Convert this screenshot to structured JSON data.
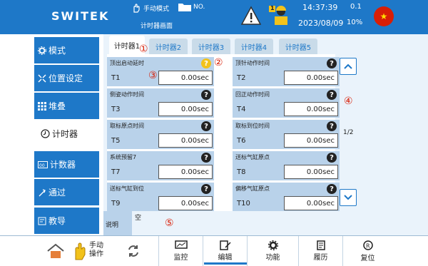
{
  "header": {
    "logo": "SWITEK",
    "mode_label": "手动模式",
    "screen_name": "计时器画面",
    "file_no": "NO.",
    "time": "14:37:39",
    "date": "2023/08/09",
    "rate": "0.1",
    "percent": "10%",
    "flag_icon": "china-flag-icon",
    "user_badge": "1"
  },
  "sidebar": {
    "items": [
      {
        "label": "模式",
        "icon": "gear-icon"
      },
      {
        "label": "位置设定",
        "icon": "arrows-icon"
      },
      {
        "label": "堆叠",
        "icon": "grid-icon"
      },
      {
        "label": "计时器",
        "icon": "clock-icon"
      },
      {
        "label": "计数器",
        "icon": "counter-icon"
      },
      {
        "label": "通过",
        "icon": "pass-icon"
      },
      {
        "label": "教导",
        "icon": "teach-icon"
      }
    ]
  },
  "tabs": [
    "计时器1",
    "计时器2",
    "计时器3",
    "计时器4",
    "计时器5"
  ],
  "timers": [
    {
      "desc": "顶出启动延时",
      "name": "T1",
      "value": "0.00sec"
    },
    {
      "desc": "顶针动作时间",
      "name": "T2",
      "value": "0.00sec"
    },
    {
      "desc": "侧姿动作时间",
      "name": "T3",
      "value": "0.00sec"
    },
    {
      "desc": "回正动作时间",
      "name": "T4",
      "value": "0.00sec"
    },
    {
      "desc": "取标原点时间",
      "name": "T5",
      "value": "0.00sec"
    },
    {
      "desc": "取标到位时间",
      "name": "T6",
      "value": "0.00sec"
    },
    {
      "desc": "系统预留7",
      "name": "T7",
      "value": "0.00sec"
    },
    {
      "desc": "送标气缸原点",
      "name": "T8",
      "value": "0.00sec"
    },
    {
      "desc": "送标气缸到位",
      "name": "T9",
      "value": "0.00sec"
    },
    {
      "desc": "偏移气缸原点",
      "name": "T10",
      "value": "0.00sec"
    }
  ],
  "pagination": "1/2",
  "annotations": [
    "①",
    "②",
    "③",
    "④",
    "⑤"
  ],
  "note": {
    "label": "说明",
    "text": "空"
  },
  "bottom": {
    "hand_label_1": "手动",
    "hand_label_2": "操作",
    "buttons": [
      "监控",
      "编辑",
      "功能",
      "履历",
      "复位"
    ]
  },
  "colors": {
    "primary": "#1e78c8",
    "cell": "#b9d2ea",
    "accent": "#d81e06"
  }
}
